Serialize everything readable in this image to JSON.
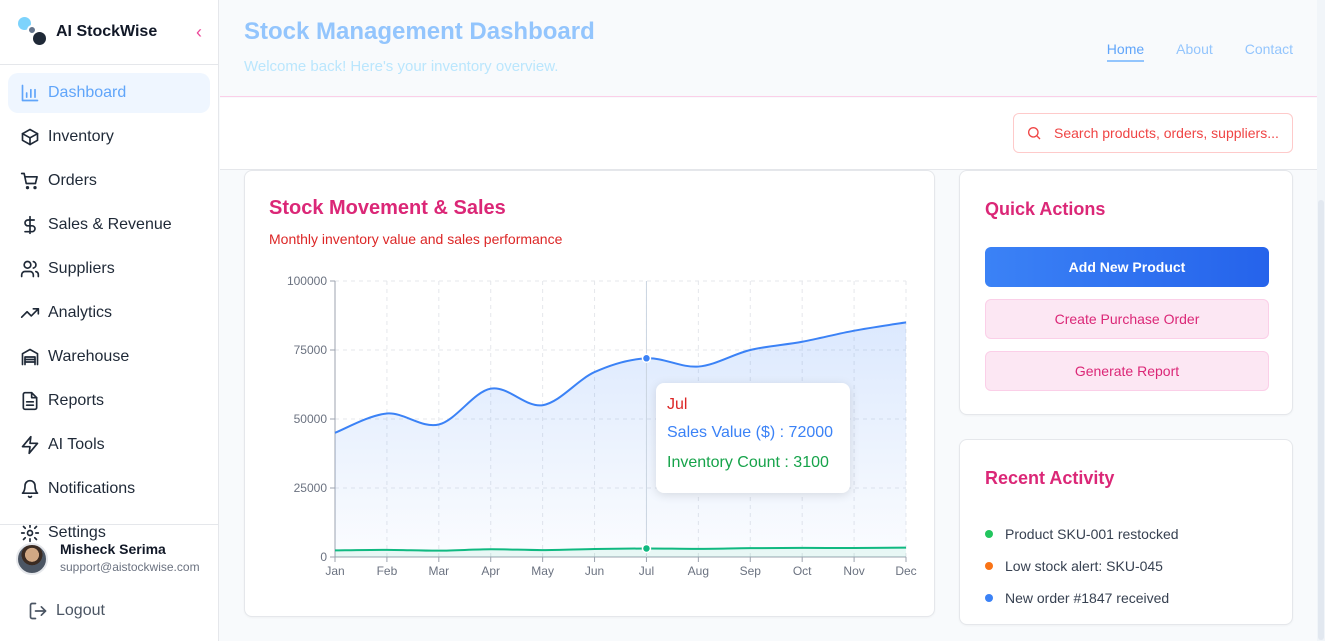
{
  "sidebar": {
    "brand": "AI StockWise",
    "items": [
      {
        "label": "Dashboard",
        "icon": "bar-chart-icon",
        "active": true
      },
      {
        "label": "Inventory",
        "icon": "package-icon"
      },
      {
        "label": "Orders",
        "icon": "cart-icon"
      },
      {
        "label": "Sales & Revenue",
        "icon": "dollar-icon"
      },
      {
        "label": "Suppliers",
        "icon": "users-icon"
      },
      {
        "label": "Analytics",
        "icon": "trending-up-icon"
      },
      {
        "label": "Warehouse",
        "icon": "warehouse-icon"
      },
      {
        "label": "Reports",
        "icon": "file-text-icon"
      },
      {
        "label": "AI Tools",
        "icon": "zap-icon"
      },
      {
        "label": "Notifications",
        "icon": "bell-icon"
      },
      {
        "label": "Settings",
        "icon": "gear-icon"
      }
    ],
    "user": {
      "name": "Misheck Serima",
      "email": "support@aistockwise.com"
    },
    "logout": "Logout"
  },
  "header": {
    "title": "Stock Management Dashboard",
    "subtitle": "Welcome back! Here's your inventory overview.",
    "nav": [
      "Home",
      "About",
      "Contact"
    ]
  },
  "search": {
    "placeholder": "Search products, orders, suppliers..."
  },
  "chart_card": {
    "title": "Stock Movement & Sales",
    "subtitle": "Monthly inventory value and sales performance"
  },
  "chart_data": {
    "type": "area",
    "x": [
      "Jan",
      "Feb",
      "Mar",
      "Apr",
      "May",
      "Jun",
      "Jul",
      "Aug",
      "Sep",
      "Oct",
      "Nov",
      "Dec"
    ],
    "ylim": [
      0,
      100000
    ],
    "yticks": [
      0,
      25000,
      50000,
      75000,
      100000
    ],
    "grid": true,
    "series": [
      {
        "name": "Sales Value ($)",
        "color": "#3b82f6",
        "values": [
          45000,
          52000,
          48000,
          61000,
          55000,
          67000,
          72000,
          69000,
          75000,
          78000,
          82000,
          85000
        ]
      },
      {
        "name": "Inventory Count",
        "color": "#10b981",
        "values": [
          2400,
          2600,
          2300,
          2800,
          2500,
          2900,
          3100,
          2950,
          3200,
          3300,
          3250,
          3400
        ]
      }
    ],
    "tooltip": {
      "month": "Jul",
      "sales": "Sales Value ($) : 72000",
      "inventory": "Inventory Count : 3100"
    }
  },
  "quick_actions": {
    "title": "Quick Actions",
    "buttons": [
      "Add New Product",
      "Create Purchase Order",
      "Generate Report"
    ]
  },
  "recent_activity": {
    "title": "Recent Activity",
    "items": [
      {
        "text": "Product SKU-001 restocked",
        "color": "#22c55e"
      },
      {
        "text": "Low stock alert: SKU-045",
        "color": "#f97316"
      },
      {
        "text": "New order #1847 received",
        "color": "#3b82f6"
      }
    ]
  }
}
